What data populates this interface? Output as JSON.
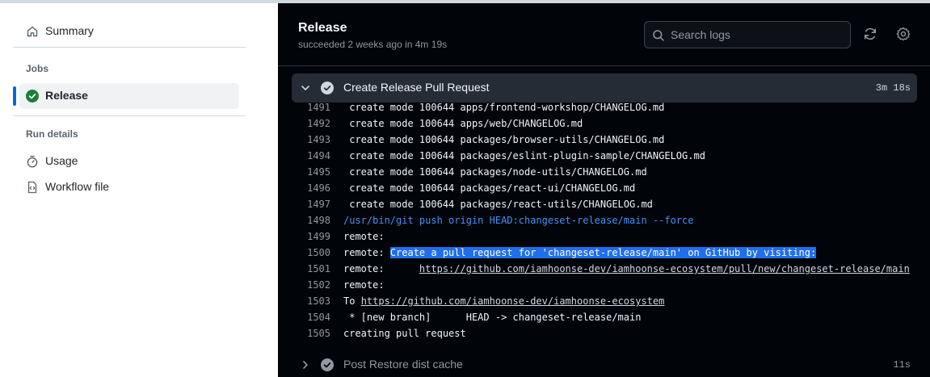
{
  "sidebar": {
    "summary_label": "Summary",
    "jobs_heading": "Jobs",
    "release_label": "Release",
    "run_details_heading": "Run details",
    "usage_label": "Usage",
    "workflow_file_label": "Workflow file"
  },
  "header": {
    "title": "Release",
    "status": "succeeded 2 weeks ago in 4m 19s",
    "search_placeholder": "Search logs"
  },
  "step_expanded": {
    "title": "Create Release Pull Request",
    "duration": "3m 18s"
  },
  "log_lines": [
    {
      "n": "1491",
      "t": " create mode 100644 apps/frontend-workshop/CHANGELOG.md"
    },
    {
      "n": "1492",
      "t": " create mode 100644 apps/web/CHANGELOG.md"
    },
    {
      "n": "1493",
      "t": " create mode 100644 packages/browser-utils/CHANGELOG.md"
    },
    {
      "n": "1494",
      "t": " create mode 100644 packages/eslint-plugin-sample/CHANGELOG.md"
    },
    {
      "n": "1495",
      "t": " create mode 100644 packages/node-utils/CHANGELOG.md"
    },
    {
      "n": "1496",
      "t": " create mode 100644 packages/react-ui/CHANGELOG.md"
    },
    {
      "n": "1497",
      "t": " create mode 100644 packages/react-utils/CHANGELOG.md"
    },
    {
      "n": "1498",
      "t": "/usr/bin/git push origin HEAD:changeset-release/main --force"
    },
    {
      "n": "1499",
      "t": "remote:"
    },
    {
      "n": "1500",
      "t": "remote: ",
      "hl": "Create a pull request for 'changeset-release/main' on GitHub by visiting:"
    },
    {
      "n": "1501",
      "t": "remote:      ",
      "link": "https://github.com/iamhoonse-dev/iamhoonse-ecosystem/pull/new/changeset-release/main"
    },
    {
      "n": "1502",
      "t": "remote:"
    },
    {
      "n": "1503",
      "t": "To ",
      "link": "https://github.com/iamhoonse-dev/iamhoonse-ecosystem"
    },
    {
      "n": "1504",
      "t": " * [new branch]      HEAD -> changeset-release/main"
    },
    {
      "n": "1505",
      "t": "creating pull request"
    }
  ],
  "step_collapsed": {
    "title": "Post Restore dist cache",
    "duration": "11s"
  },
  "colors": {
    "success_green": "#1a7f37",
    "active_accent": "#0969da",
    "log_background": "#010409",
    "selection_highlight": "#1f6feb",
    "command_blue": "#4493f8"
  },
  "icons": {
    "summary": "home-icon",
    "release_status": "check-circle-fill-icon",
    "usage": "stopwatch-icon",
    "workflow_file": "file-code-icon",
    "search": "search-icon",
    "refresh": "sync-icon",
    "settings": "gear-icon",
    "expanded": "chevron-down-icon",
    "collapsed": "chevron-right-icon",
    "step_status": "check-circle-fill-icon"
  }
}
